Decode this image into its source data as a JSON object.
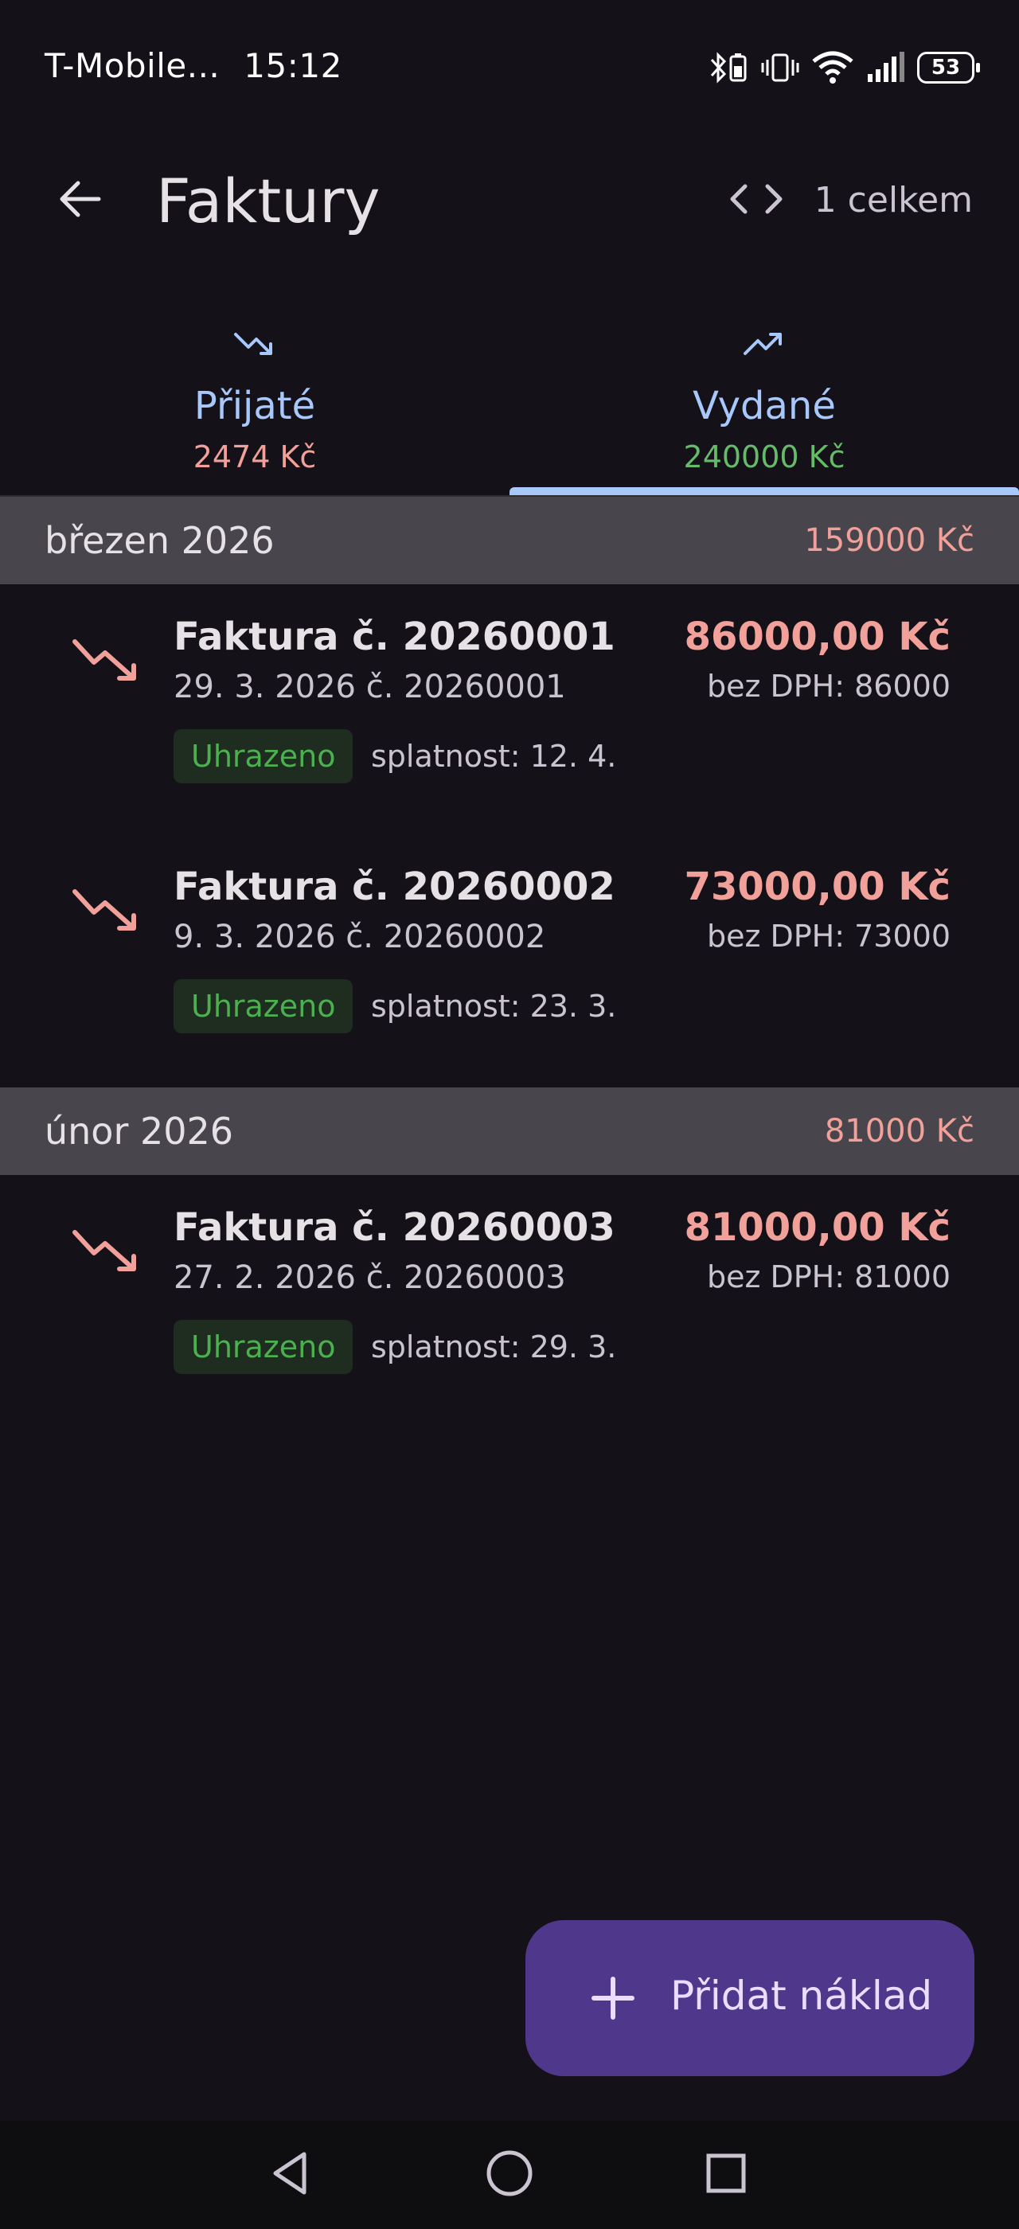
{
  "status_bar": {
    "carrier": "T-Mobile...",
    "time": "15:12",
    "battery": "53",
    "icons": [
      "bluetooth-battery-icon",
      "vibrate-icon",
      "wifi-icon",
      "signal-icon",
      "battery-icon"
    ]
  },
  "app_bar": {
    "title": "Faktury",
    "count_label": "1 celkem",
    "icons": [
      "back-arrow-icon",
      "code-icon"
    ]
  },
  "tabs": [
    {
      "label": "Přijaté",
      "sum": "2474 Kč",
      "icon": "trending-down-icon",
      "sum_color": "#f2a09a",
      "selected": false
    },
    {
      "label": "Vydané",
      "sum": "240000 Kč",
      "icon": "trending-up-icon",
      "sum_color": "#66bb6a",
      "selected": true
    }
  ],
  "groups": [
    {
      "month": "březen 2026",
      "total": "159000 Kč",
      "invoices": [
        {
          "title": "Faktura č. 20260001",
          "subtitle": "29. 3. 2026  č. 20260001",
          "amount": "86000,00 Kč",
          "net": "bez DPH: 86000",
          "status": "Uhrazeno",
          "due": "splatnost: 12. 4."
        },
        {
          "title": "Faktura č. 20260002",
          "subtitle": "9. 3. 2026  č. 20260002",
          "amount": "73000,00 Kč",
          "net": "bez DPH: 73000",
          "status": "Uhrazeno",
          "due": "splatnost: 23. 3."
        }
      ]
    },
    {
      "month": "únor 2026",
      "total": "81000 Kč",
      "invoices": [
        {
          "title": "Faktura č. 20260003",
          "subtitle": "27. 2. 2026  č. 20260003",
          "amount": "81000,00 Kč",
          "net": "bez DPH: 81000",
          "status": "Uhrazeno",
          "due": "splatnost: 29. 3."
        }
      ]
    }
  ],
  "fab": {
    "label": "Přidat náklad",
    "icon": "plus-icon"
  },
  "colors": {
    "accent": "#a8c7fa",
    "expense": "#f2a09a",
    "income": "#66bb6a",
    "paid": "#4caf50",
    "fab": "#4f378b"
  },
  "nav_bar": {
    "icons": [
      "back-triangle-icon",
      "home-circle-icon",
      "recents-square-icon"
    ]
  }
}
